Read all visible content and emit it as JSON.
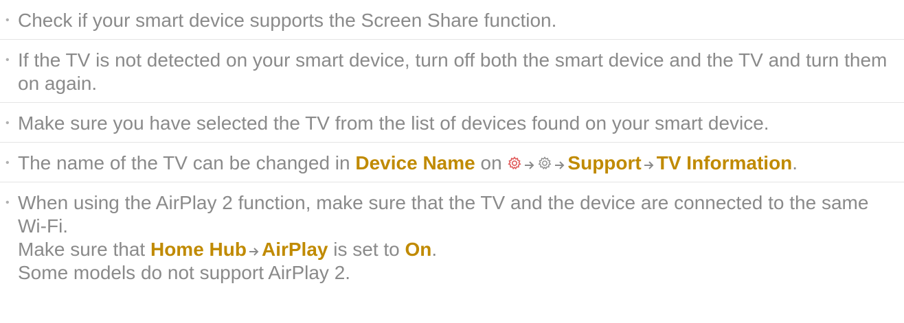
{
  "items": [
    {
      "text": "Check if your smart device supports the Screen Share function."
    },
    {
      "text": "If the TV is not detected on your smart device, turn off both the smart device and the TV and turn them on again."
    },
    {
      "text": "Make sure you have selected the TV from the list of devices found on your smart device."
    },
    {
      "prefix": "The name of the TV can be changed in ",
      "device_name": "Device Name",
      "on_word": " on ",
      "support": "Support",
      "tv_information": "TV Information",
      "suffix": "."
    },
    {
      "line1": "When using the AirPlay 2 function, make sure that the TV and the device are connected to the same Wi-Fi.",
      "line2_prefix": "Make sure that ",
      "home_hub": "Home Hub",
      "airplay": "AirPlay",
      "line2_mid": " is set to ",
      "on": "On",
      "line2_suffix": ".",
      "line3": "Some models do not support AirPlay 2."
    }
  ],
  "icons": {
    "bullet": "bullet-dot",
    "arrow": "arrow-right-icon",
    "settings_red": "settings-gear-icon-red",
    "settings_gray": "settings-gear-icon-gray"
  },
  "colors": {
    "text": "#8a8a8a",
    "highlight": "#c08a00",
    "gear_red": "#e05a5a",
    "gear_gray": "#8a8a8a"
  }
}
